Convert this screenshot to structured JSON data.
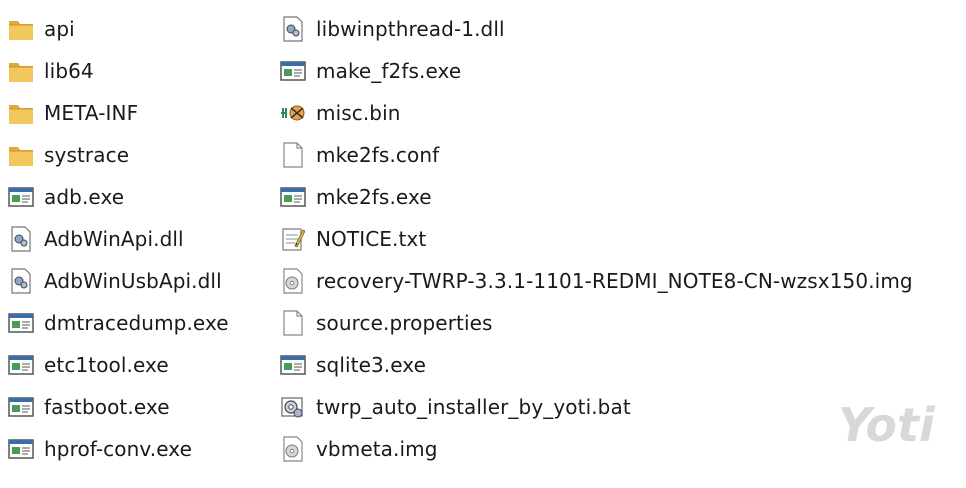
{
  "watermark": "Yoti",
  "left_items": [
    {
      "label": "api",
      "icon": "folder-icon"
    },
    {
      "label": "lib64",
      "icon": "folder-icon"
    },
    {
      "label": "META-INF",
      "icon": "folder-icon"
    },
    {
      "label": "systrace",
      "icon": "folder-icon"
    },
    {
      "label": "adb.exe",
      "icon": "exe-icon"
    },
    {
      "label": "AdbWinApi.dll",
      "icon": "dll-icon"
    },
    {
      "label": "AdbWinUsbApi.dll",
      "icon": "dll-icon"
    },
    {
      "label": "dmtracedump.exe",
      "icon": "exe-icon"
    },
    {
      "label": "etc1tool.exe",
      "icon": "exe-icon"
    },
    {
      "label": "fastboot.exe",
      "icon": "exe-icon"
    },
    {
      "label": "hprof-conv.exe",
      "icon": "exe-icon"
    }
  ],
  "right_items": [
    {
      "label": "libwinpthread-1.dll",
      "icon": "dll-icon"
    },
    {
      "label": "make_f2fs.exe",
      "icon": "exe-icon"
    },
    {
      "label": "misc.bin",
      "icon": "bin-icon"
    },
    {
      "label": "mke2fs.conf",
      "icon": "blank-file-icon"
    },
    {
      "label": "mke2fs.exe",
      "icon": "exe-icon"
    },
    {
      "label": "NOTICE.txt",
      "icon": "text-file-icon"
    },
    {
      "label": "recovery-TWRP-3.3.1-1101-REDMI_NOTE8-CN-wzsx150.img",
      "icon": "disc-image-icon"
    },
    {
      "label": "source.properties",
      "icon": "blank-file-icon"
    },
    {
      "label": "sqlite3.exe",
      "icon": "exe-icon"
    },
    {
      "label": "twrp_auto_installer_by_yoti.bat",
      "icon": "batch-file-icon"
    },
    {
      "label": "vbmeta.img",
      "icon": "disc-image-icon"
    }
  ],
  "colors": {
    "folder": "#e8b84a",
    "exe_header": "#3a6ea5",
    "text": "#1a1a1a",
    "watermark": "#d8d8d8"
  }
}
